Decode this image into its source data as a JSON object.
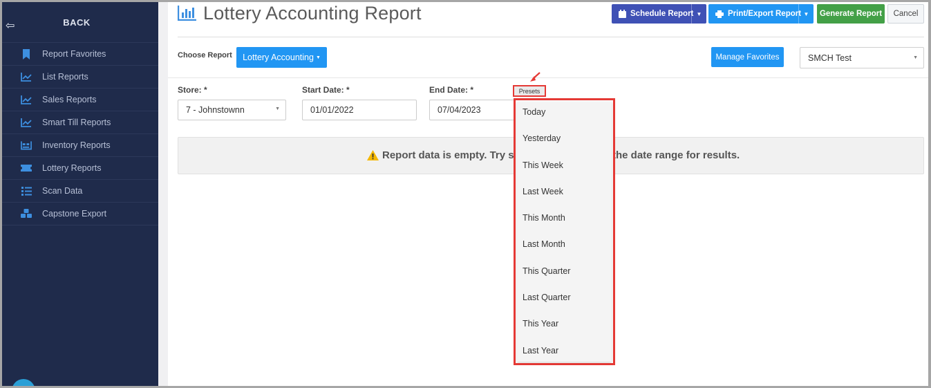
{
  "sidebar": {
    "back_label": "BACK",
    "items": [
      {
        "label": "Report Favorites",
        "icon": "bookmark-icon"
      },
      {
        "label": "List Reports",
        "icon": "chart-line-icon"
      },
      {
        "label": "Sales Reports",
        "icon": "chart-line-icon"
      },
      {
        "label": "Smart Till Reports",
        "icon": "chart-line-icon"
      },
      {
        "label": "Inventory Reports",
        "icon": "inventory-icon"
      },
      {
        "label": "Lottery Reports",
        "icon": "ticket-icon"
      },
      {
        "label": "Scan Data",
        "icon": "list-icon"
      },
      {
        "label": "Capstone Export",
        "icon": "cubes-icon"
      }
    ]
  },
  "header": {
    "title": "Lottery Accounting Report",
    "schedule_label": "Schedule Report",
    "print_label": "Print/Export Report",
    "generate_label": "Generate Report",
    "cancel_label": "Cancel"
  },
  "toolbar": {
    "choose_label": "Choose Report",
    "report_button": "Lottery Accounting",
    "favorites_button": "Manage Favorites",
    "store_select_value": "SMCH Test"
  },
  "filters": {
    "store_label": "Store: *",
    "store_value": "7 - Johnstownn",
    "start_label": "Start Date: *",
    "start_value": "01/01/2022",
    "end_label": "End Date: *",
    "end_value": "07/04/2023"
  },
  "empty_message": {
    "left": "Report data is empty. Try se",
    "right": "the date range for results."
  },
  "presets": {
    "label": "Presets",
    "items": [
      "Today",
      "Yesterday",
      "This Week",
      "Last Week",
      "This Month",
      "Last Month",
      "This Quarter",
      "Last Quarter",
      "This Year",
      "Last Year"
    ]
  },
  "colors": {
    "sidebar_bg": "#1f2b4b",
    "primary": "#2196f3",
    "indigo": "#3f51b5",
    "success": "#43a047",
    "highlight": "#e53935",
    "icon_blue": "#3d8fe0"
  }
}
